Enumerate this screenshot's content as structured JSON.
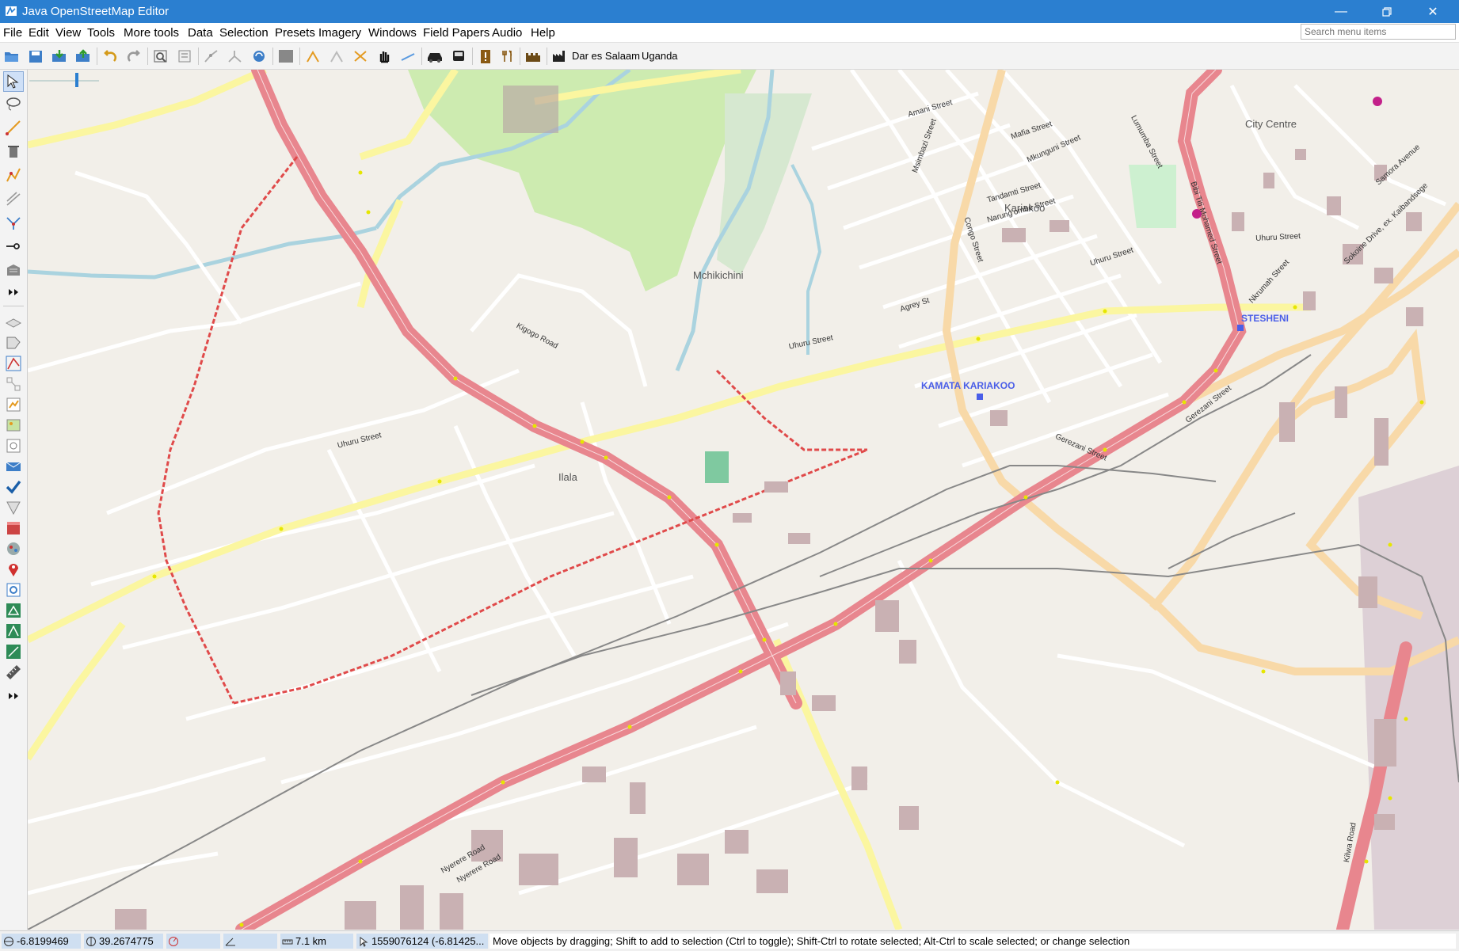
{
  "window": {
    "title": "Java OpenStreetMap Editor"
  },
  "menu": {
    "items": [
      "File",
      "Edit",
      "View",
      "Tools",
      "More tools",
      "Data",
      "Selection",
      "Presets",
      "Imagery",
      "Windows",
      "Field Papers",
      "Audio",
      "Help"
    ],
    "search_placeholder": "Search menu items"
  },
  "toolbar": {
    "preset_labels": [
      "Dar es Salaam",
      "Uganda"
    ]
  },
  "map": {
    "places": [
      "City Centre",
      "Kariakoo",
      "Mchikichini",
      "Ilala"
    ],
    "stations": [
      "KAMATA KARIAKOO",
      "STESHENI"
    ],
    "streets": {
      "kilwa_road": "Kilwa Road",
      "uhuru_street_w": "Uhuru Street",
      "uhuru_street_c": "Uhuru Street",
      "uhuru_street_e": "Uhuru Street",
      "uhuru_street_ne": "Uhuru Street",
      "nyerere_road_1": "Nyerere Road",
      "nyerere_road_2": "Nyerere Road",
      "gerezani_street_w": "Gerezani Street",
      "gerezani_street_e": "Gerezani Street",
      "msimbazi_street": "Msimbazi Street",
      "nkrumah_street": "Nkrumah Street",
      "samora_avenue": "Samora Avenue",
      "sokoine_drive": "Sokoine Drive, ex. Kaibandsege",
      "bibi_titi": "Bibi Titi Mohamed Street",
      "lumumba_street": "Lumumba Street",
      "agrey_street": "Agrey St",
      "mafia_street": "Mafia Street",
      "tandamti_street": "Tandamti Street",
      "narung_ombe": "Narung'ombe Street",
      "congo_street": "Congo Street",
      "mkunguni_street": "Mkunguni Street",
      "amani_street": "Amani Street",
      "uhuru_kigogo": "Kigogo Road"
    }
  },
  "status": {
    "lat": "-6.8199469",
    "lon": "39.2674775",
    "heading": "",
    "angle": "",
    "distance": "7.1 km",
    "node": "1559076124 (-6.81425...",
    "help_text": "Move objects by dragging; Shift to add to selection (Ctrl to toggle); Shift-Ctrl to rotate selected; Alt-Ctrl to scale selected; or change selection"
  },
  "colors": {
    "titlebar": "#2b7fd0",
    "map_bg": "#f2efe9",
    "primary_road": "#e8868e",
    "secondary_road": "#f8d9a8",
    "tertiary_road": "#fbf6a0",
    "park": "#cdebb0",
    "water": "#aad3df",
    "station_label": "#4a5ee8"
  },
  "icons": {
    "app": "josm-app-icon",
    "minimize": "minimize-icon",
    "maximize": "restore-icon",
    "close": "close-icon"
  }
}
